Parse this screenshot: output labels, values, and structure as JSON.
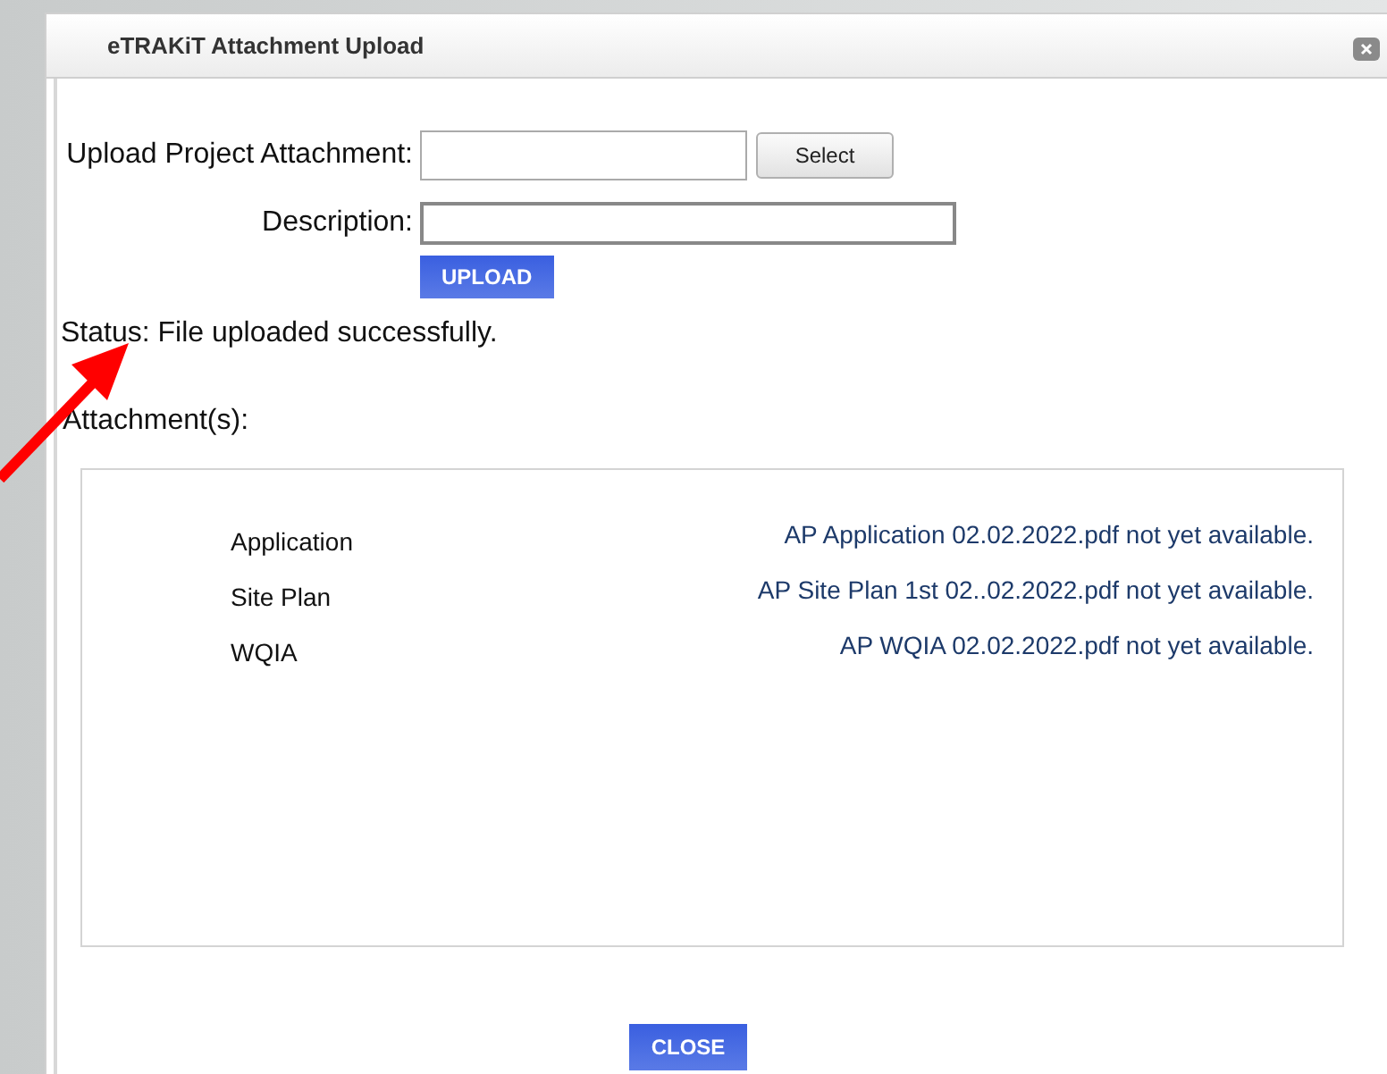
{
  "window": {
    "title": "eTRAKiT Attachment Upload"
  },
  "form": {
    "upload_label": "Upload Project Attachment:",
    "select_button": "Select",
    "description_label": "Description:",
    "upload_button": "UPLOAD"
  },
  "status": "Status: File uploaded successfully.",
  "attachments_label": "Attachment(s):",
  "attachments": [
    {
      "name": "Application",
      "file": "AP Application 02.02.2022.pdf not yet available."
    },
    {
      "name": "Site Plan",
      "file": "AP Site Plan 1st 02..02.2022.pdf not yet available."
    },
    {
      "name": "WQIA",
      "file": "AP WQIA 02.02.2022.pdf not yet available."
    }
  ],
  "close_button": "CLOSE"
}
